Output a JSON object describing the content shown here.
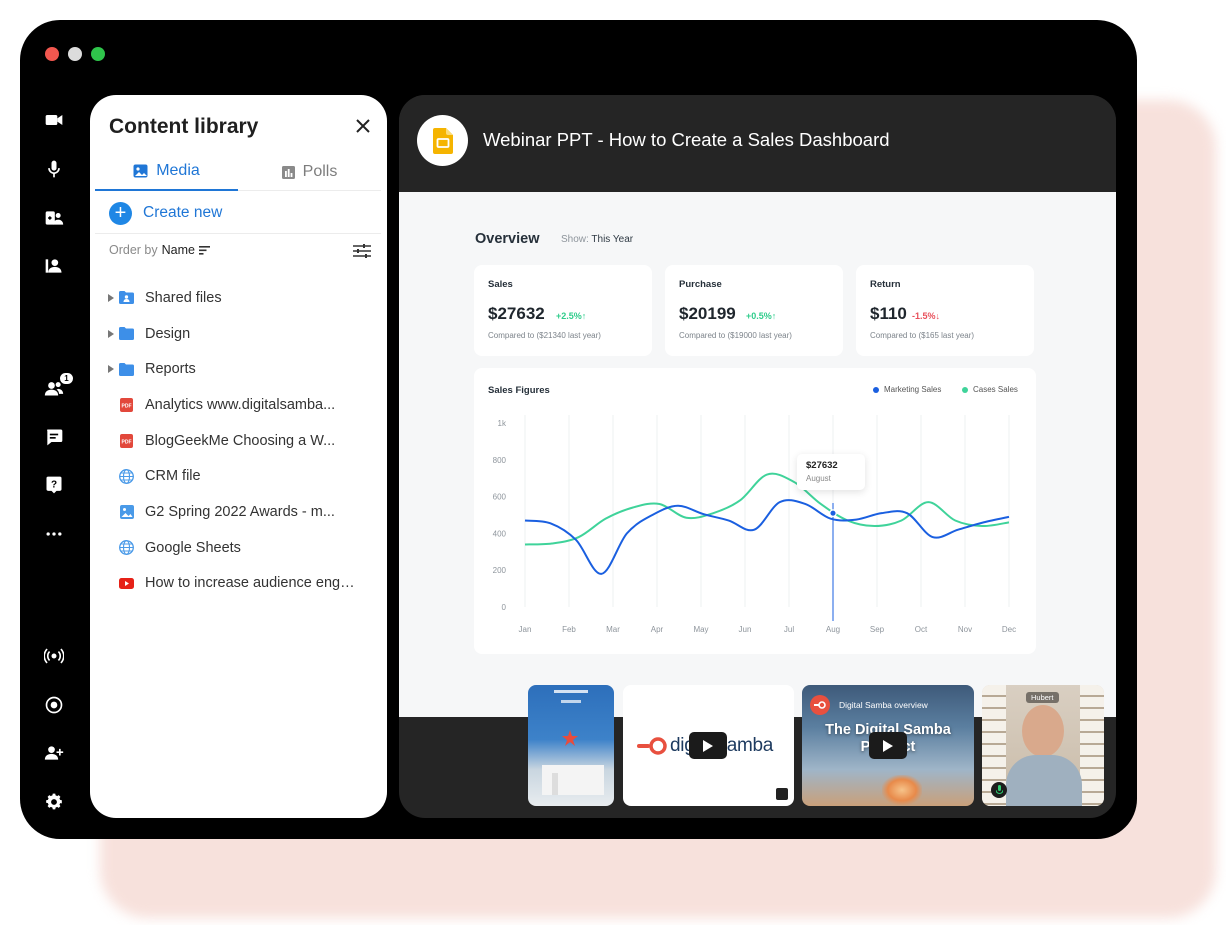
{
  "sidebar_icons": [
    "video-camera-icon",
    "microphone-icon",
    "share-screen-icon",
    "presenter-icon",
    "participants-icon",
    "chat-icon",
    "qa-icon",
    "more-icon",
    "broadcast-icon",
    "record-icon",
    "invite-user-icon",
    "settings-icon"
  ],
  "participants_badge": "1",
  "library": {
    "title": "Content library",
    "tabs": [
      {
        "label": "Media",
        "active": true
      },
      {
        "label": "Polls",
        "active": false
      }
    ],
    "create_label": "Create new",
    "order_prefix": "Order by",
    "order_value": "Name",
    "items": [
      {
        "label": "Shared files",
        "icon": "shared-folder-icon",
        "expandable": true
      },
      {
        "label": "Design",
        "icon": "folder-icon",
        "expandable": true
      },
      {
        "label": "Reports",
        "icon": "folder-icon",
        "expandable": true
      },
      {
        "label": "Analytics www.digitalsamba...",
        "icon": "pdf-icon",
        "expandable": false
      },
      {
        "label": "BlogGeekMe Choosing a W...",
        "icon": "pdf-icon",
        "expandable": false
      },
      {
        "label": "CRM file",
        "icon": "web-icon",
        "expandable": false
      },
      {
        "label": "G2 Spring 2022 Awards - m...",
        "icon": "image-icon",
        "expandable": false
      },
      {
        "label": "Google Sheets",
        "icon": "web-icon",
        "expandable": false
      },
      {
        "label": "How to increase audience enga...",
        "icon": "youtube-icon",
        "expandable": false
      }
    ]
  },
  "presentation": {
    "title": "Webinar PPT -  How to Create a Sales Dashboard",
    "overview": {
      "title": "Overview",
      "show_prefix": "Show:",
      "show_value": "This Year"
    },
    "kpis": [
      {
        "label": "Sales",
        "value": "$27632",
        "change": "+2.5%↑",
        "positive": true,
        "compare": "Compared to ($21340 last year)"
      },
      {
        "label": "Purchase",
        "value": "$20199",
        "change": "+0.5%↑",
        "positive": true,
        "compare": "Compared to ($19000 last year)"
      },
      {
        "label": "Return",
        "value": "$110",
        "change": "-1.5%↓",
        "positive": false,
        "compare": "Compared to ($165 last year)"
      }
    ]
  },
  "chart_data": {
    "type": "line",
    "title": "Sales Figures",
    "categories": [
      "Jan",
      "Feb",
      "Mar",
      "Apr",
      "May",
      "Jun",
      "Jul",
      "Aug",
      "Sep",
      "Oct",
      "Nov",
      "Dec"
    ],
    "x": [
      0,
      0.5,
      1,
      1.5,
      2,
      2.5,
      3,
      3.5,
      4,
      4.5,
      5,
      5.5,
      6,
      6.5,
      7,
      7.5,
      8,
      8.5,
      9,
      9.5,
      10,
      10.5,
      11
    ],
    "y_ticks": [
      "0",
      "200",
      "400",
      "600",
      "800",
      "1k"
    ],
    "ylim": [
      0,
      1000
    ],
    "series": [
      {
        "name": "Marketing Sales",
        "color": "#1a5fe0",
        "values": [
          470,
          455,
          365,
          180,
          400,
          500,
          550,
          505,
          470,
          420,
          570,
          560,
          480,
          475,
          510,
          510,
          380,
          420,
          460,
          490
        ]
      },
      {
        "name": "Cases Sales",
        "color": "#3fd39a",
        "values": [
          340,
          345,
          380,
          480,
          540,
          560,
          485,
          510,
          580,
          720,
          680,
          560,
          470,
          440,
          470,
          570,
          470,
          440,
          460
        ]
      }
    ],
    "tooltip": {
      "value": "$27632",
      "label": "August"
    },
    "legend_position": "top-right",
    "grid": true
  },
  "thumbnails": {
    "brand_name": "digitalsamba",
    "video_title": "Digital Samba overview",
    "video_overlay": "The Digital Samba Product",
    "participant_name": "Hubert"
  },
  "colors": {
    "accent": "#1f76d6",
    "positive": "#2ecc8b",
    "negative": "#e8505b",
    "marketing": "#1a5fe0",
    "cases": "#3fd39a"
  }
}
